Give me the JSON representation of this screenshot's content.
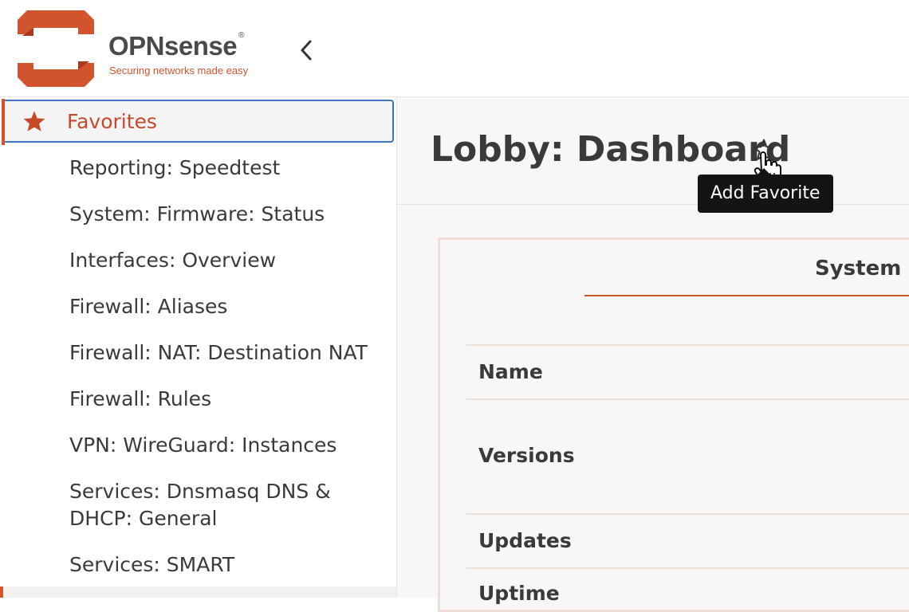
{
  "brand": {
    "name": "OPNsense",
    "registered_mark": "®",
    "tagline": "Securing networks made easy",
    "accent_color": "#d2542e"
  },
  "header": {
    "collapse_icon": "chevron-left-icon"
  },
  "sidebar": {
    "favorites": {
      "label": "Favorites",
      "icon": "star-filled-icon"
    },
    "items": [
      {
        "label": "Reporting: Speedtest"
      },
      {
        "label": "System: Firmware: Status"
      },
      {
        "label": "Interfaces: Overview"
      },
      {
        "label": "Firewall: Aliases"
      },
      {
        "label": "Firewall: NAT: Destination NAT"
      },
      {
        "label": "Firewall: Rules"
      },
      {
        "label": "VPN: WireGuard: Instances"
      },
      {
        "label": "Services: Dnsmasq DNS & DHCP: General"
      },
      {
        "label": "Services: SMART"
      }
    ]
  },
  "main": {
    "page_title": "Lobby: Dashboard",
    "favorite_toggle_icon": "star-outline-icon",
    "tooltip": "Add Favorite",
    "widget": {
      "title": "System In",
      "rows": [
        {
          "label": "Name"
        },
        {
          "label": "Versions"
        },
        {
          "label": "Updates"
        },
        {
          "label": "Uptime"
        }
      ]
    }
  }
}
